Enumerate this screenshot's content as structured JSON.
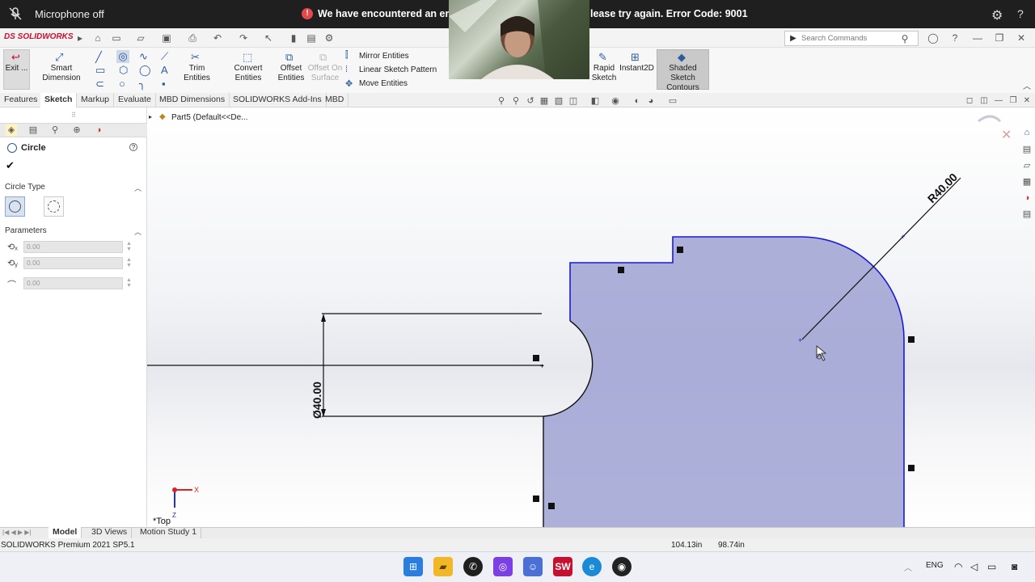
{
  "meeting": {
    "mic_status": "Microphone off",
    "error_part1": "We have encountered an error",
    "error_part2": "lease try again. Error Code: 9001"
  },
  "app": {
    "logo": "DS SOLIDWORKS",
    "search_placeholder": "Search Commands"
  },
  "commands": {
    "exit": "Exit ...",
    "smart_dimension": "Smart Dimension",
    "trim": "Trim Entities",
    "convert": "Convert Entities",
    "offset": "Offset Entities",
    "offset_surface": "Offset On Surface",
    "mirror": "Mirror Entities",
    "linear_pattern": "Linear Sketch Pattern",
    "move": "Move Entities",
    "rapid_sketch": "Rapid Sketch",
    "instant2d": "Instant2D",
    "shaded": "Shaded Sketch Contours"
  },
  "tabs": [
    "Features",
    "Sketch",
    "Markup",
    "Evaluate",
    "MBD Dimensions",
    "SOLIDWORKS Add-Ins",
    "MBD"
  ],
  "active_tab": "Sketch",
  "feature_tree": {
    "part_label": "Part5  (Default<<De..."
  },
  "property_manager": {
    "title": "Circle",
    "circle_type_label": "Circle Type",
    "parameters_label": "Parameters",
    "param_x": "0.00",
    "param_y": "0.00",
    "param_r": "0.00"
  },
  "sketch": {
    "radius_dim": "R40.00",
    "diameter_dim": "Ø40.00",
    "view_label": "*Top",
    "axis_x": "X",
    "axis_z": "Z"
  },
  "bottom_tabs": [
    "Model",
    "3D Views",
    "Motion Study 1"
  ],
  "active_bottom_tab": "Model",
  "status": {
    "product": "SOLIDWORKS Premium 2021 SP5.1",
    "coord_x": "104.13in",
    "coord_y": "98.74in"
  },
  "taskbar": {
    "lang": "ENG"
  },
  "colors": {
    "sketch_fill": "#9fa2d2",
    "sketch_edge": "#1a1ad6",
    "topbar": "#1f1f1f",
    "error_red": "#e5484d"
  }
}
